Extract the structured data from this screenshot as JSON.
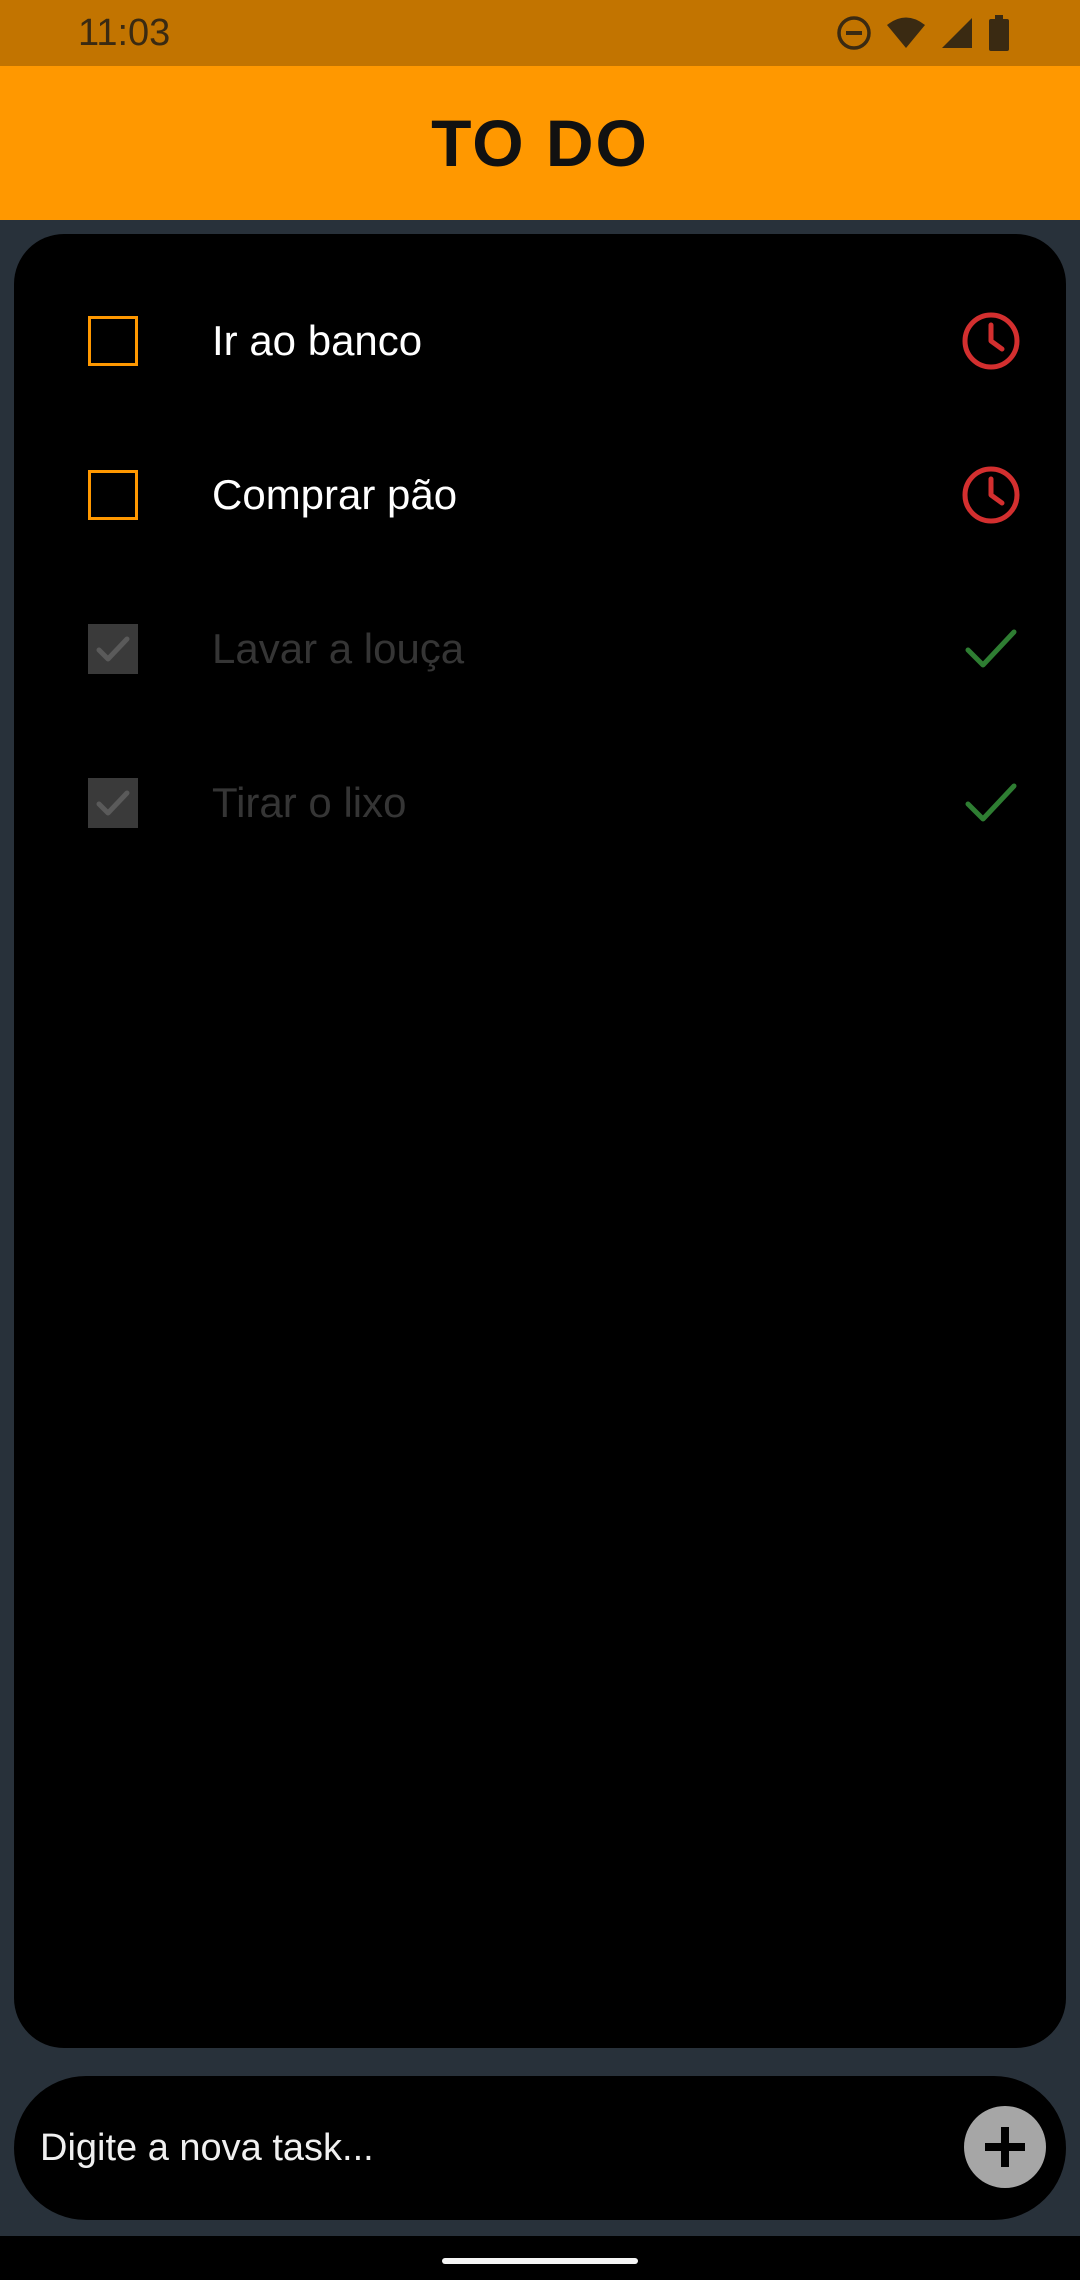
{
  "status_bar": {
    "time": "11:03",
    "icons": [
      "do-not-disturb-icon",
      "wifi-icon",
      "signal-icon",
      "battery-icon"
    ]
  },
  "app_bar": {
    "title": "TO DO",
    "background_color": "#ff9800"
  },
  "tasks": [
    {
      "label": "Ir ao banco",
      "done": false,
      "status_icon": "clock-icon",
      "status_color": "#d32f2f"
    },
    {
      "label": "Comprar pão",
      "done": false,
      "status_icon": "clock-icon",
      "status_color": "#d32f2f"
    },
    {
      "label": "Lavar a louça",
      "done": true,
      "status_icon": "check-icon",
      "status_color": "#2e7d32"
    },
    {
      "label": "Tirar o lixo",
      "done": true,
      "status_icon": "check-icon",
      "status_color": "#2e7d32"
    }
  ],
  "input": {
    "placeholder": "Digite a nova task...",
    "value": "",
    "add_icon": "plus-icon"
  }
}
